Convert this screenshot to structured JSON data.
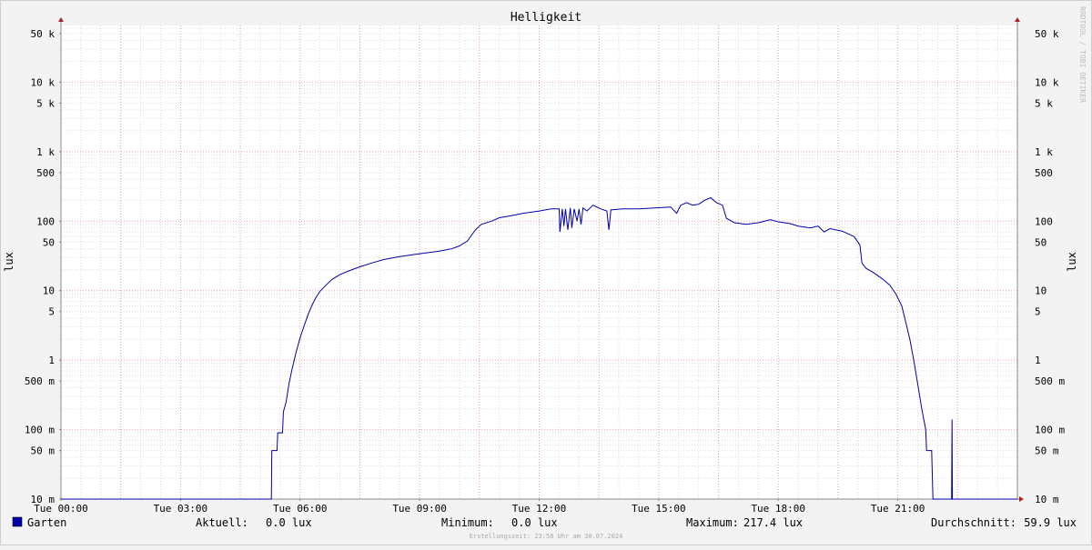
{
  "chart_data": {
    "type": "line",
    "title": "Helligkeit",
    "ylabel_left": "lux",
    "ylabel_right": "lux",
    "y_scale": "log",
    "ylim": [
      0.01,
      100000
    ],
    "xlim_hours": [
      0,
      24
    ],
    "x_ticks": [
      {
        "h": 0,
        "label": "Tue 00:00"
      },
      {
        "h": 3,
        "label": "Tue 03:00"
      },
      {
        "h": 6,
        "label": "Tue 06:00"
      },
      {
        "h": 9,
        "label": "Tue 09:00"
      },
      {
        "h": 12,
        "label": "Tue 12:00"
      },
      {
        "h": 15,
        "label": "Tue 15:00"
      },
      {
        "h": 18,
        "label": "Tue 18:00"
      },
      {
        "h": 21,
        "label": "Tue 21:00"
      }
    ],
    "y_ticks": [
      {
        "v": 50000,
        "label": "50 k"
      },
      {
        "v": 10000,
        "label": "10 k"
      },
      {
        "v": 5000,
        "label": "5 k"
      },
      {
        "v": 1000,
        "label": "1 k"
      },
      {
        "v": 500,
        "label": "500"
      },
      {
        "v": 100,
        "label": "100"
      },
      {
        "v": 50,
        "label": "50"
      },
      {
        "v": 10,
        "label": "10"
      },
      {
        "v": 5,
        "label": "5"
      },
      {
        "v": 1,
        "label": "1"
      },
      {
        "v": 0.5,
        "label": "500 m"
      },
      {
        "v": 0.1,
        "label": "100 m"
      },
      {
        "v": 0.05,
        "label": "50 m"
      },
      {
        "v": 0.01,
        "label": "10 m"
      }
    ],
    "series": [
      {
        "name": "Garten",
        "color": "#0000aa",
        "points": [
          [
            0,
            0.01
          ],
          [
            5.28,
            0.01
          ],
          [
            5.29,
            0.05
          ],
          [
            5.42,
            0.05
          ],
          [
            5.44,
            0.09
          ],
          [
            5.56,
            0.09
          ],
          [
            5.58,
            0.18
          ],
          [
            5.65,
            0.25
          ],
          [
            5.72,
            0.45
          ],
          [
            5.8,
            0.75
          ],
          [
            5.9,
            1.3
          ],
          [
            6.0,
            2.1
          ],
          [
            6.1,
            3.1
          ],
          [
            6.2,
            4.5
          ],
          [
            6.3,
            6.2
          ],
          [
            6.4,
            8.0
          ],
          [
            6.5,
            9.8
          ],
          [
            6.65,
            12.0
          ],
          [
            6.8,
            14.5
          ],
          [
            7.0,
            17.0
          ],
          [
            7.2,
            19.0
          ],
          [
            7.5,
            22.0
          ],
          [
            7.8,
            25.0
          ],
          [
            8.1,
            28.0
          ],
          [
            8.5,
            31.0
          ],
          [
            9.0,
            34.0
          ],
          [
            9.5,
            37.0
          ],
          [
            9.8,
            40.0
          ],
          [
            10.0,
            44.0
          ],
          [
            10.2,
            52.0
          ],
          [
            10.4,
            75.0
          ],
          [
            10.55,
            90.0
          ],
          [
            10.8,
            100.0
          ],
          [
            11.0,
            112.0
          ],
          [
            11.3,
            120.0
          ],
          [
            11.6,
            130.0
          ],
          [
            12.0,
            140.0
          ],
          [
            12.3,
            150.0
          ],
          [
            12.5,
            150.0
          ],
          [
            12.52,
            70.0
          ],
          [
            12.58,
            150.0
          ],
          [
            12.62,
            85.0
          ],
          [
            12.66,
            150.0
          ],
          [
            12.72,
            75.0
          ],
          [
            12.78,
            155.0
          ],
          [
            12.82,
            80.0
          ],
          [
            12.88,
            150.0
          ],
          [
            12.95,
            100.0
          ],
          [
            13.0,
            150.0
          ],
          [
            13.05,
            90.0
          ],
          [
            13.1,
            155.0
          ],
          [
            13.2,
            140.0
          ],
          [
            13.35,
            170.0
          ],
          [
            13.55,
            150.0
          ],
          [
            13.7,
            140.0
          ],
          [
            13.75,
            75.0
          ],
          [
            13.8,
            145.0
          ],
          [
            14.1,
            150.0
          ],
          [
            14.5,
            150.0
          ],
          [
            14.9,
            155.0
          ],
          [
            15.3,
            160.0
          ],
          [
            15.45,
            130.0
          ],
          [
            15.55,
            170.0
          ],
          [
            15.7,
            185.0
          ],
          [
            15.85,
            170.0
          ],
          [
            16.0,
            175.0
          ],
          [
            16.15,
            200.0
          ],
          [
            16.3,
            217.4
          ],
          [
            16.45,
            185.0
          ],
          [
            16.6,
            170.0
          ],
          [
            16.7,
            110.0
          ],
          [
            16.9,
            95.0
          ],
          [
            17.2,
            90.0
          ],
          [
            17.5,
            95.0
          ],
          [
            17.8,
            105.0
          ],
          [
            18.0,
            98.0
          ],
          [
            18.3,
            92.0
          ],
          [
            18.5,
            85.0
          ],
          [
            18.8,
            80.0
          ],
          [
            19.0,
            85.0
          ],
          [
            19.15,
            70.0
          ],
          [
            19.3,
            78.0
          ],
          [
            19.6,
            72.0
          ],
          [
            19.9,
            60.0
          ],
          [
            20.0,
            50.0
          ],
          [
            20.05,
            45.0
          ],
          [
            20.1,
            25.0
          ],
          [
            20.2,
            21.0
          ],
          [
            20.4,
            18.0
          ],
          [
            20.6,
            15.0
          ],
          [
            20.8,
            12.0
          ],
          [
            20.95,
            9.0
          ],
          [
            21.1,
            6.0
          ],
          [
            21.2,
            3.5
          ],
          [
            21.3,
            2.0
          ],
          [
            21.4,
            1.0
          ],
          [
            21.5,
            0.45
          ],
          [
            21.6,
            0.2
          ],
          [
            21.7,
            0.1
          ],
          [
            21.72,
            0.05
          ],
          [
            21.85,
            0.05
          ],
          [
            21.88,
            0.01
          ],
          [
            22.35,
            0.01
          ],
          [
            22.36,
            0.14
          ],
          [
            22.37,
            0.01
          ],
          [
            24,
            0.01
          ]
        ]
      }
    ]
  },
  "legend": {
    "series_name": "Garten",
    "current_label": "Aktuell:",
    "current_value": "0.0 lux",
    "min_label": "Minimum:",
    "min_value": "0.0 lux",
    "max_label": "Maximum:",
    "max_value": "217.4 lux",
    "avg_label": "Durchschnitt:",
    "avg_value": "59.9 lux"
  },
  "footer": "Erstellungszeit: 23:58 Uhr am 30.07.2024",
  "watermark": "RRDTOOL / TOBI OETIKER",
  "colors": {
    "background": "#f3f3f3",
    "canvas": "#ffffff",
    "major_grid": "#e8a0a0",
    "minor_grid": "#dcdcdc",
    "axis": "#888888",
    "arrow": "#aa2222",
    "series": "#0000aa"
  }
}
